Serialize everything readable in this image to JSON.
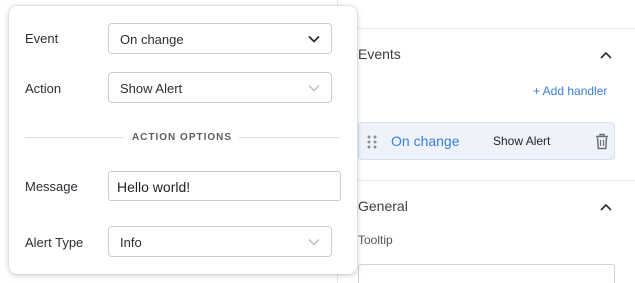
{
  "inspector": {
    "events_section": {
      "title": "Events",
      "add_handler_label": "+ Add handler",
      "handler": {
        "event": "On change",
        "action": "Show Alert"
      }
    },
    "general_section": {
      "title": "General",
      "tooltip_label": "Tooltip",
      "tooltip_value": ""
    }
  },
  "popover": {
    "event": {
      "label": "Event",
      "value": "On change"
    },
    "action": {
      "label": "Action",
      "value": "Show Alert"
    },
    "action_options_heading": "ACTION OPTIONS",
    "message": {
      "label": "Message",
      "value": "Hello world!"
    },
    "alert_type": {
      "label": "Alert Type",
      "value": "Info"
    }
  },
  "colors": {
    "accent": "#3a7fd5",
    "handler_bg": "#eef3fb",
    "border": "#c9cdd3"
  },
  "icons": [
    "chevron-up-icon",
    "drag-handle-icon",
    "trash-icon",
    "chevron-down-icon"
  ]
}
